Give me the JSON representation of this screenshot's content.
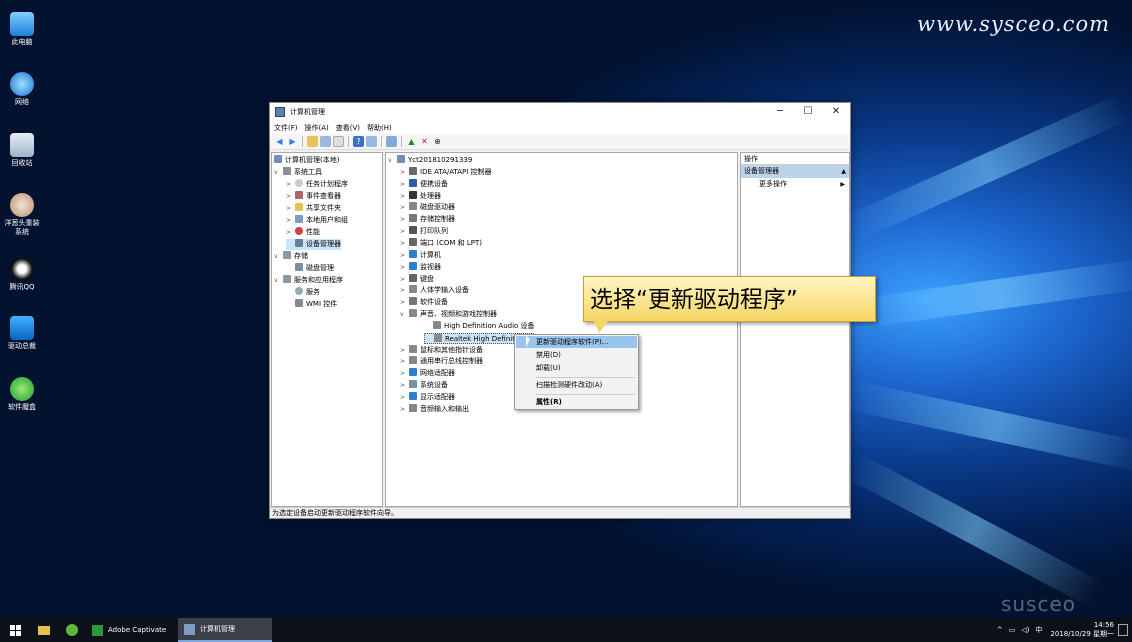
{
  "watermark": "www.sysceo.com",
  "brand_watermark": "susceo",
  "desktop_icons": [
    {
      "label": "此电脑",
      "icon": "computer-icon"
    },
    {
      "label": "网络",
      "icon": "network-icon"
    },
    {
      "label": "回收站",
      "icon": "recycle-bin-icon"
    },
    {
      "label": "洋葱头重装系统",
      "icon": "onion-app-icon"
    },
    {
      "label": "腾讯QQ",
      "icon": "qq-icon"
    },
    {
      "label": "驱动总裁",
      "icon": "driver-app-icon"
    },
    {
      "label": "软件魔盒",
      "icon": "software-box-icon"
    }
  ],
  "window": {
    "title": "计算机管理",
    "minimize": "─",
    "maximize": "☐",
    "close": "✕",
    "menu": [
      "文件(F)",
      "操作(A)",
      "查看(V)",
      "帮助(H)"
    ]
  },
  "left_tree": [
    {
      "label": "计算机管理(本地)",
      "arrow": ""
    },
    {
      "label": "系统工具",
      "arrow": "v"
    },
    {
      "label": "任务计划程序",
      "arrow": ">"
    },
    {
      "label": "事件查看器",
      "arrow": ">"
    },
    {
      "label": "共享文件夹",
      "arrow": ">"
    },
    {
      "label": "本地用户和组",
      "arrow": ">"
    },
    {
      "label": "性能",
      "arrow": ">"
    },
    {
      "label": "设备管理器",
      "arrow": ""
    },
    {
      "label": "存储",
      "arrow": "v"
    },
    {
      "label": "磁盘管理",
      "arrow": ""
    },
    {
      "label": "服务和应用程序",
      "arrow": "v"
    },
    {
      "label": "服务",
      "arrow": ""
    },
    {
      "label": "WMI 控件",
      "arrow": ""
    }
  ],
  "device_tree": [
    {
      "label": "Yct201810291339",
      "arrow": "v"
    },
    {
      "label": "IDE ATA/ATAPI 控制器",
      "arrow": ">"
    },
    {
      "label": "便携设备",
      "arrow": ">"
    },
    {
      "label": "处理器",
      "arrow": ">"
    },
    {
      "label": "磁盘驱动器",
      "arrow": ">"
    },
    {
      "label": "存储控制器",
      "arrow": ">"
    },
    {
      "label": "打印队列",
      "arrow": ">"
    },
    {
      "label": "端口 (COM 和 LPT)",
      "arrow": ">"
    },
    {
      "label": "计算机",
      "arrow": ">"
    },
    {
      "label": "监视器",
      "arrow": ">"
    },
    {
      "label": "键盘",
      "arrow": ">"
    },
    {
      "label": "人体学输入设备",
      "arrow": ">"
    },
    {
      "label": "软件设备",
      "arrow": ">"
    },
    {
      "label": "声音、视频和游戏控制器",
      "arrow": "v"
    },
    {
      "label": "High Definition Audio 设备",
      "arrow": ""
    },
    {
      "label": "Realtek High Definition A",
      "arrow": ""
    },
    {
      "label": "鼠标和其他指针设备",
      "arrow": ">"
    },
    {
      "label": "通用串行总线控制器",
      "arrow": ">"
    },
    {
      "label": "网络适配器",
      "arrow": ">"
    },
    {
      "label": "系统设备",
      "arrow": ">"
    },
    {
      "label": "显示适配器",
      "arrow": ">"
    },
    {
      "label": "音频输入和输出",
      "arrow": ">"
    }
  ],
  "actions": {
    "header": "操作",
    "section": "设备管理器",
    "more": "更多操作"
  },
  "context_menu": [
    "更新驱动程序软件(P)...",
    "禁用(D)",
    "卸载(U)",
    "扫描检测硬件改动(A)",
    "属性(R)"
  ],
  "callout": "选择“更新驱动程序”",
  "status": "为选定设备启动更新驱动程序软件向导。",
  "taskbar": {
    "items": [
      "Adobe Captivate",
      "计算机管理"
    ],
    "ime": "中",
    "time": "14:56",
    "date": "2018/10/29 星期一"
  }
}
